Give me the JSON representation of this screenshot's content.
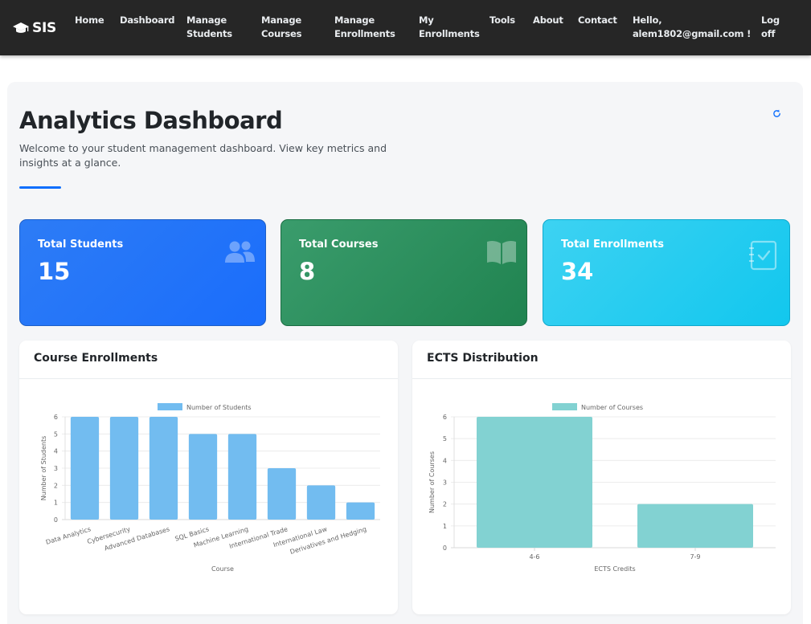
{
  "navbar": {
    "brand": "SIS",
    "links": [
      {
        "line1": "Home",
        "line2": ""
      },
      {
        "line1": "Dashboard",
        "line2": ""
      },
      {
        "line1": "Manage",
        "line2": "Students"
      },
      {
        "line1": "Manage",
        "line2": "Courses"
      },
      {
        "line1": "Manage",
        "line2": "Enrollments"
      },
      {
        "line1": "My",
        "line2": "Enrollments"
      },
      {
        "line1": "Tools",
        "line2": ""
      },
      {
        "line1": "About",
        "line2": ""
      },
      {
        "line1": "Contact",
        "line2": ""
      }
    ],
    "greeting_line1": "Hello,",
    "greeting_line2": "alem1802@gmail.com !",
    "logout_line1": "Log",
    "logout_line2": "off",
    "background": "#262626"
  },
  "header": {
    "title": "Analytics Dashboard",
    "description": "Welcome to your student management dashboard. View key metrics and insights at a glance.",
    "accent": "#0d6efd",
    "refresh_icon": "refresh-icon"
  },
  "stats": [
    {
      "label": "Total Students",
      "value": "15",
      "icon": "users-icon",
      "color": "#1d6ff8"
    },
    {
      "label": "Total Courses",
      "value": "8",
      "icon": "book-icon",
      "color": "#2a8c5c"
    },
    {
      "label": "Total Enrollments",
      "value": "34",
      "icon": "clipboard-check-icon",
      "color": "#22ccf0"
    }
  ],
  "charts": {
    "enrollments_title": "Course Enrollments",
    "ects_title": "ECTS Distribution"
  },
  "chart_data": [
    {
      "type": "bar",
      "title": "",
      "categories": [
        "Data Analytics",
        "Cybersecurity",
        "Advanced Databases",
        "SQL Basics",
        "Machine Learning",
        "International Trade",
        "International Law",
        "Derivatives and Hedging"
      ],
      "series": [
        {
          "name": "Number of Students",
          "values": [
            6,
            6,
            6,
            5,
            5,
            3,
            2,
            1
          ]
        }
      ],
      "xlabel": "Course",
      "ylabel": "Number of Students",
      "ylim": [
        0,
        6
      ],
      "yticks": [
        0,
        1,
        2,
        3,
        4,
        5,
        6
      ],
      "color": "#72bcf0",
      "legend": "top",
      "grid": true
    },
    {
      "type": "bar",
      "title": "",
      "categories": [
        "4-6",
        "7-9"
      ],
      "series": [
        {
          "name": "Number of Courses",
          "values": [
            6,
            2
          ]
        }
      ],
      "xlabel": "ECTS Credits",
      "ylabel": "Number of Courses",
      "ylim": [
        0,
        6
      ],
      "yticks": [
        0,
        1,
        2,
        3,
        4,
        5,
        6
      ],
      "color": "#82d2d2",
      "legend": "top",
      "grid": true
    }
  ]
}
